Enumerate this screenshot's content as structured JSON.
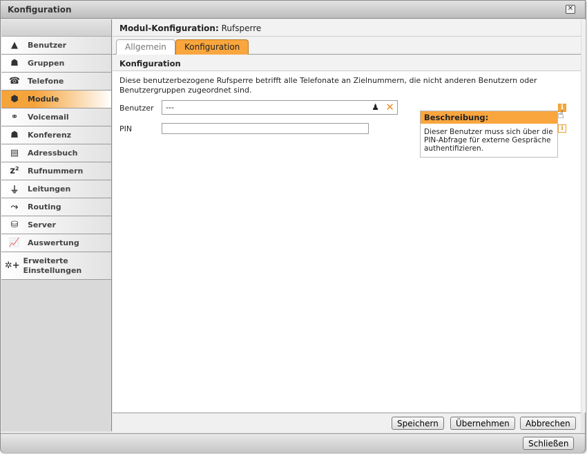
{
  "window": {
    "title": "Konfiguration",
    "close_icon": "close-icon"
  },
  "sidebar": {
    "items": [
      {
        "label": "Benutzer",
        "icon": "user-icon",
        "glyph": "▲"
      },
      {
        "label": "Gruppen",
        "icon": "group-icon",
        "glyph": "☗"
      },
      {
        "label": "Telefone",
        "icon": "phone-icon",
        "glyph": "☎"
      },
      {
        "label": "Module",
        "icon": "module-box-icon",
        "glyph": "⬢",
        "active": true
      },
      {
        "label": "Voicemail",
        "icon": "voicemail-icon",
        "glyph": "⚭"
      },
      {
        "label": "Konferenz",
        "icon": "conference-icon",
        "glyph": "☗"
      },
      {
        "label": "Adressbuch",
        "icon": "address-book-icon",
        "glyph": "▤"
      },
      {
        "label": "Rufnummern",
        "icon": "numbers-icon",
        "glyph": "z²"
      },
      {
        "label": "Leitungen",
        "icon": "plug-icon",
        "glyph": "⏚"
      },
      {
        "label": "Routing",
        "icon": "routing-icon",
        "glyph": "⤳"
      },
      {
        "label": "Server",
        "icon": "server-icon",
        "glyph": "⛁"
      },
      {
        "label": "Auswertung",
        "icon": "chart-icon",
        "glyph": "📈"
      },
      {
        "label": "Erweiterte Einstellungen",
        "icon": "advanced-settings-icon",
        "glyph": "✲+"
      }
    ]
  },
  "main": {
    "header_bold": "Modul-Konfiguration:",
    "header_value": "Rufsperre",
    "tabs": [
      {
        "label": "Allgemein"
      },
      {
        "label": "Konfiguration",
        "active": true
      }
    ],
    "section_title": "Konfiguration",
    "description": "Diese benutzerbezogene Rufsperre betrifft alle Telefonate an Zielnummern, die nicht anderen Benutzern oder Benutzergruppen zugeordnet sind.",
    "fields": {
      "benutzer_label": "Benutzer",
      "benutzer_value": "---",
      "pin_label": "PIN",
      "pin_value": ""
    },
    "tooltip": {
      "title": "Beschreibung:",
      "text": "Dieser Benutzer muss sich über die PIN-Abfrage für externe Gespräche authentifizieren."
    }
  },
  "buttons": {
    "save": "Speichern",
    "apply": "Übernehmen",
    "cancel": "Abbrechen",
    "close": "Schließen"
  },
  "colors": {
    "accent": "#f9a63e"
  }
}
